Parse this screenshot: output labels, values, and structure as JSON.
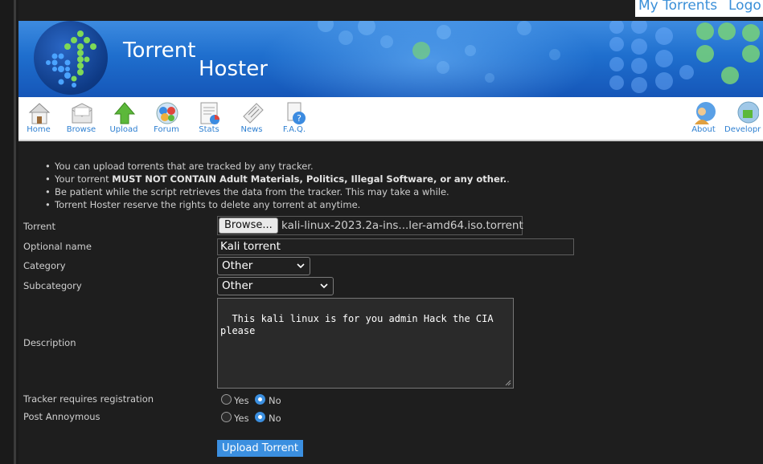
{
  "top_links": {
    "my_torrents": "My Torrents",
    "logout": "Logo"
  },
  "brand": {
    "line1": "Torrent",
    "line2": "Hoster"
  },
  "nav": {
    "items": [
      {
        "label": "Home",
        "icon": "home-icon"
      },
      {
        "label": "Browse",
        "icon": "browse-icon"
      },
      {
        "label": "Upload",
        "icon": "upload-icon"
      },
      {
        "label": "Forum",
        "icon": "forum-icon"
      },
      {
        "label": "Stats",
        "icon": "stats-icon"
      },
      {
        "label": "News",
        "icon": "news-icon"
      },
      {
        "label": "F.A.Q.",
        "icon": "faq-icon"
      }
    ],
    "right_items": [
      {
        "label": "About",
        "icon": "about-icon"
      },
      {
        "label": "Developr",
        "icon": "developer-icon"
      }
    ]
  },
  "rules": {
    "r1": "You can upload torrents that are tracked by any tracker.",
    "r2_prefix": "Your torrent ",
    "r2_bold": "MUST NOT CONTAIN Adult Materials, Politics, Illegal Software, or any other.",
    "r2_suffix": ".",
    "r3": "Be patient while the script retrieves the data from the tracker. This may take a while.",
    "r4": "Torrent Hoster reserve the rights to delete any torrent at anytime."
  },
  "form": {
    "torrent_label": "Torrent",
    "browse_label": "Browse...",
    "file_name": "kali-linux-2023.2a-ins...ler-amd64.iso.torrent",
    "optional_name_label": "Optional name",
    "optional_name_value": "Kali torrent",
    "category_label": "Category",
    "category_value": "Other",
    "subcategory_label": "Subcategory",
    "subcategory_value": "Other",
    "description_label": "Description",
    "description_value": "This kali linux is for you admin Hack the CIA\nplease",
    "tracker_reg_label": "Tracker requires registration",
    "post_anon_label": "Post Annoymous",
    "yes_label": "Yes",
    "no_label": "No",
    "tracker_reg_selected": "No",
    "post_anon_selected": "No",
    "submit_label": "Upload Torrent"
  },
  "colors": {
    "accent": "#3b8fe0",
    "link": "#2d7fd1",
    "banner": "#1f6fce",
    "background": "#1e1e1e"
  }
}
